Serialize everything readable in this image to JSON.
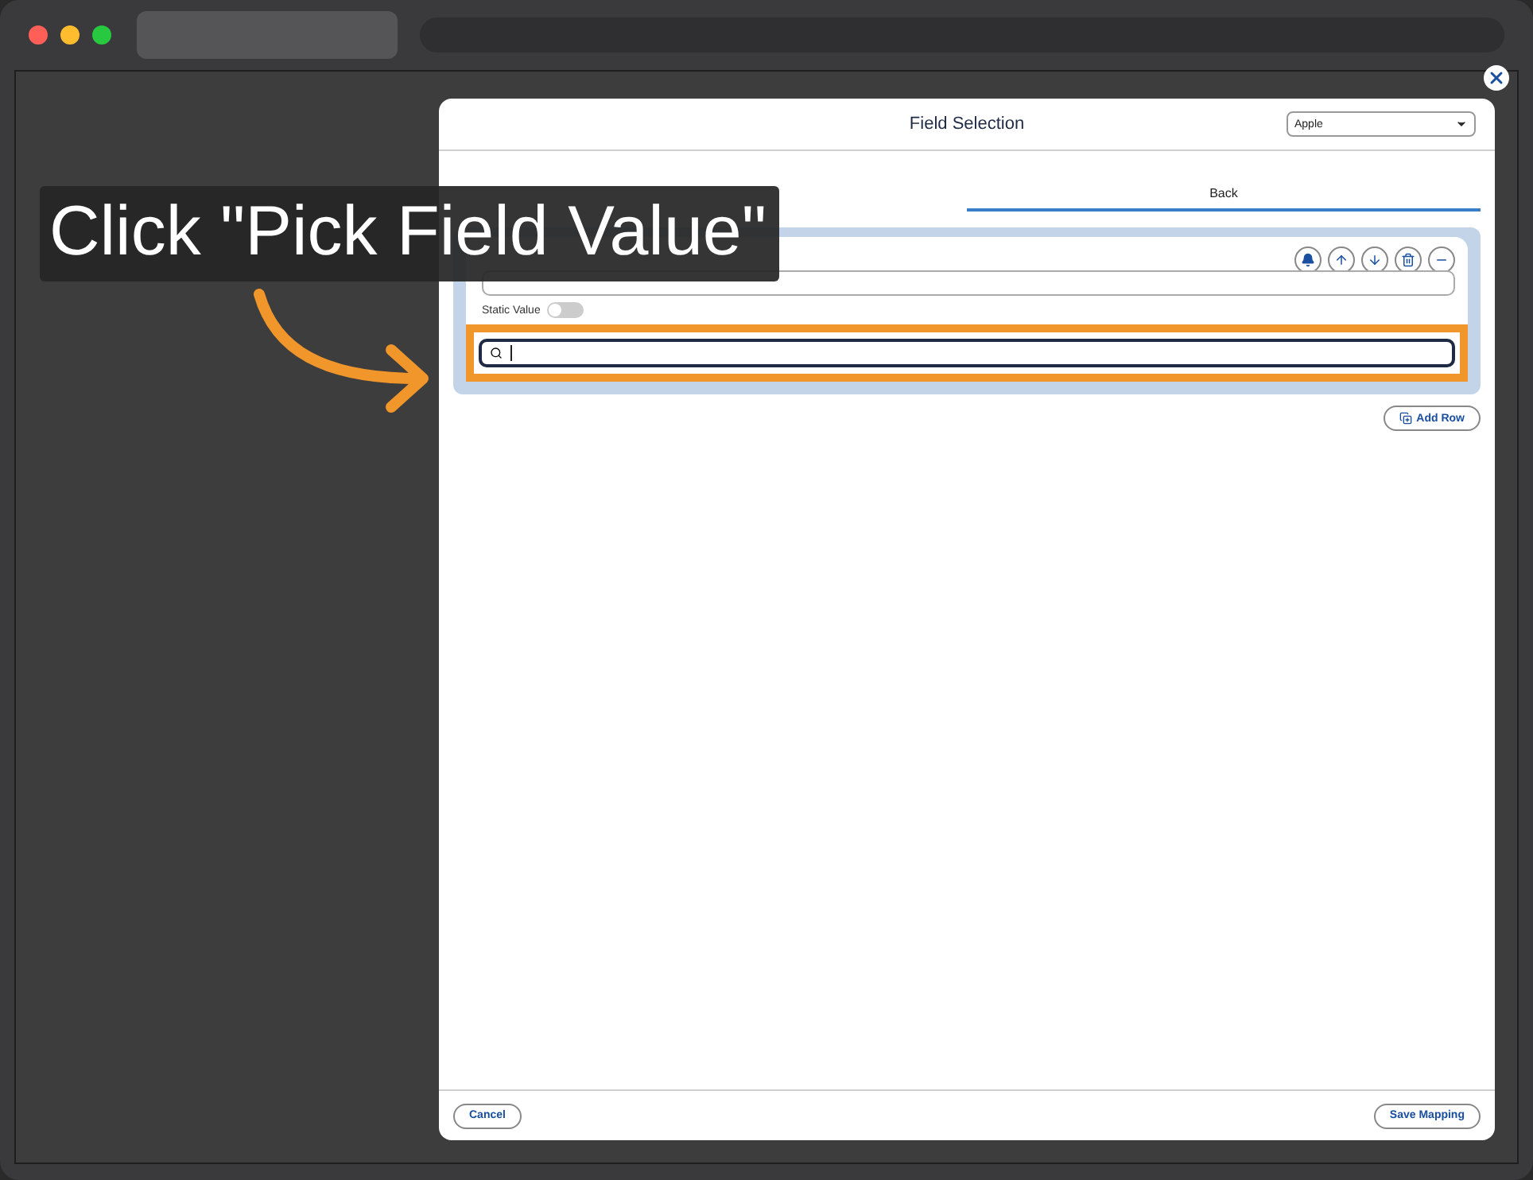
{
  "modal": {
    "title": "Field Selection",
    "dropdown": {
      "value": "Apple"
    },
    "tabs": [
      {
        "selected": false
      },
      {
        "label": "Back",
        "selected": true
      }
    ],
    "row": {
      "static_value": {
        "label": "Static Value",
        "on": false
      },
      "search": {
        "highlighted": true,
        "focused": true
      }
    },
    "add_row": "Add Row",
    "footer": {
      "cancel": "Cancel",
      "save": "Save Mapping"
    }
  },
  "callout": {
    "text": "Click \"Pick Field Value\""
  }
}
